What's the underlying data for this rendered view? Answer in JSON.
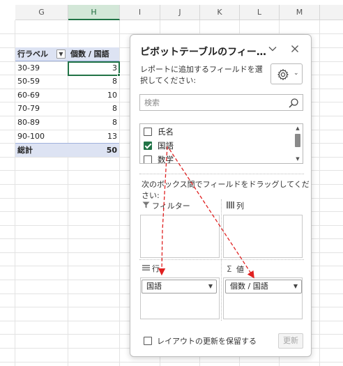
{
  "sheet": {
    "columns": [
      "G",
      "H",
      "I",
      "J",
      "K",
      "L",
      "M"
    ],
    "active_column": "H",
    "pivot": {
      "header": {
        "row_label": "行ラベル",
        "value_label": "個数 / 国語"
      },
      "rows": [
        {
          "label": "30-39",
          "value": "3"
        },
        {
          "label": "50-59",
          "value": "8"
        },
        {
          "label": "60-69",
          "value": "10"
        },
        {
          "label": "70-79",
          "value": "8"
        },
        {
          "label": "80-89",
          "value": "8"
        },
        {
          "label": "90-100",
          "value": "13"
        }
      ],
      "total": {
        "label": "総計",
        "value": "50"
      }
    }
  },
  "pane": {
    "title": "ピボットテーブルのフィー…",
    "description": "レポートに追加するフィールドを選択してください:",
    "search_placeholder": "検索",
    "fields": [
      {
        "label": "氏名",
        "checked": false
      },
      {
        "label": "国語",
        "checked": true
      },
      {
        "label": "数学",
        "checked": false
      }
    ],
    "drag_instruction": "次のボックス間でフィールドをドラッグしてください:",
    "areas": {
      "filter": {
        "label": "フィルター"
      },
      "columns": {
        "label": "列"
      },
      "rows": {
        "label": "行",
        "chip": "国語"
      },
      "values": {
        "label": "値",
        "chip": "個数 / 国語"
      }
    },
    "defer_update_label": "レイアウトの更新を保留する",
    "update_button": "更新"
  },
  "colors": {
    "accent": "#217346",
    "pivot_header_bg": "#dde3f3",
    "arrow": "#e02020"
  }
}
